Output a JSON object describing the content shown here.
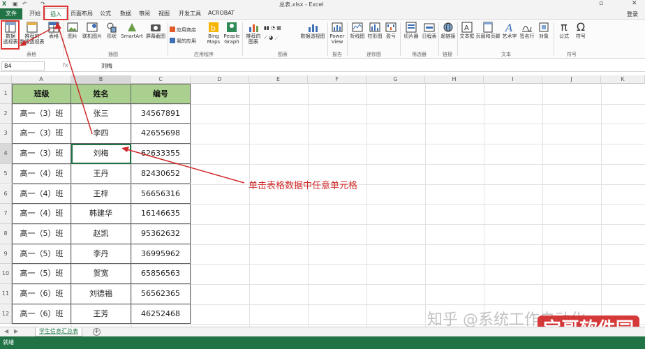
{
  "window": {
    "title": "总表.xlsx - Excel",
    "minimize_glyph": "▫",
    "close_glyph": "✕"
  },
  "tabs": [
    "文件",
    "开始",
    "插入",
    "页面布局",
    "公式",
    "数据",
    "审阅",
    "视图",
    "开发工具",
    "ACROBAT"
  ],
  "login": "登录",
  "ribbon": {
    "tables": {
      "pivot_line1": "数据",
      "pivot_line2": "透视表",
      "recommended_line1": "推荐的",
      "recommended_line2": "数据透视表",
      "table": "表格",
      "group": "表格"
    },
    "illustrations": {
      "picture": "图片",
      "online_picture": "联机图片",
      "shapes": "形状",
      "smartart": "SmartArt",
      "screenshot": "屏幕截图",
      "group": "插图"
    },
    "apps": {
      "store": "应用商店",
      "my_apps": "我的应用",
      "bing_line1": "Bing",
      "bing_line2": "Maps",
      "people_line1": "People",
      "people_line2": "Graph",
      "group": "应用程序"
    },
    "charts": {
      "recommended_line1": "推荐的",
      "recommended_line2": "图表",
      "pivot_chart": "数据透视图",
      "group": "图表"
    },
    "reports": {
      "power_line1": "Power",
      "power_line2": "View",
      "group": "报告"
    },
    "sparklines": {
      "line": "折线图",
      "column": "柱形图",
      "winloss": "盈亏",
      "group": "迷你图"
    },
    "filters": {
      "slicer": "切片器",
      "timeline": "日程表",
      "group": "筛选器"
    },
    "links": {
      "hyperlink": "超链接",
      "group": "链接"
    },
    "text": {
      "textbox": "文本框",
      "header_footer": "页眉和页脚",
      "wordart": "艺术字",
      "signature": "签名行",
      "object": "对象",
      "group": "文本"
    },
    "symbols": {
      "equation": "公式",
      "symbol": "符号",
      "group": "符号"
    }
  },
  "formula_bar": {
    "name_box": "B4",
    "fx": "fx",
    "value": "刘梅"
  },
  "columns": [
    "A",
    "B",
    "C",
    "D",
    "E",
    "F",
    "G",
    "H",
    "I",
    "J",
    "K"
  ],
  "rows": [
    "1",
    "2",
    "3",
    "4",
    "5",
    "6",
    "7",
    "8",
    "9",
    "10",
    "11",
    "12"
  ],
  "table": {
    "headers": [
      "班级",
      "姓名",
      "编号"
    ],
    "data": [
      [
        "高一（3）班",
        "张三",
        "34567891"
      ],
      [
        "高一（3）班",
        "李四",
        "42655698"
      ],
      [
        "高一（3）班",
        "刘梅",
        "62633355"
      ],
      [
        "高一（4）班",
        "王丹",
        "82430652"
      ],
      [
        "高一（4）班",
        "王梓",
        "56656316"
      ],
      [
        "高一（4）班",
        "韩建华",
        "16146635"
      ],
      [
        "高一（5）班",
        "赵凯",
        "95362632"
      ],
      [
        "高一（5）班",
        "李丹",
        "36995962"
      ],
      [
        "高一（5）班",
        "贺宽",
        "65856563"
      ],
      [
        "高一（6）班",
        "刘德福",
        "56562365"
      ],
      [
        "高一（6）班",
        "王芳",
        "46252468"
      ]
    ],
    "header_color": "#a9d08e"
  },
  "sheet_tab": "学生信息汇总表",
  "status": "就绪",
  "annotation": "单击表格数据中任意单元格",
  "watermarks": {
    "zhihu": "知乎 @系统工作自动化",
    "site": "宝哥软件园"
  },
  "colors": {
    "excel_green": "#217346",
    "annotation_red": "#d02a2a"
  }
}
